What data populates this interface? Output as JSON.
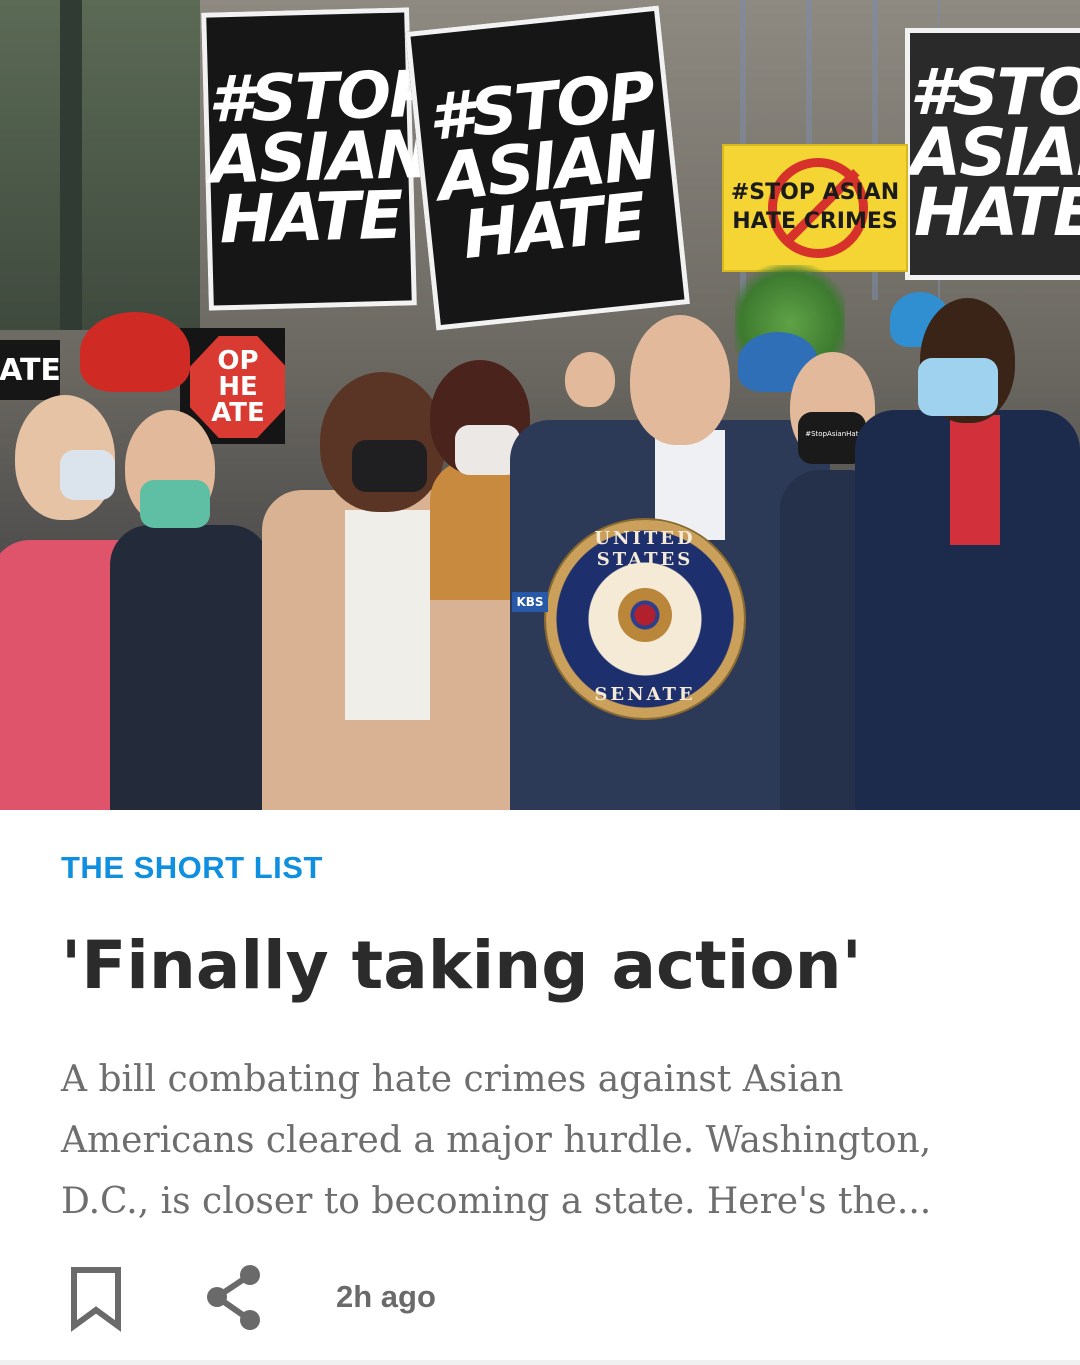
{
  "hero": {
    "signs": [
      {
        "lines": [
          "#STOP",
          "ASIAN",
          "HATE"
        ]
      },
      {
        "lines": [
          "#STOP",
          "ASIAN",
          "HATE"
        ]
      },
      {
        "lines": [
          "#STOP",
          "ASIAN",
          "HATE"
        ]
      }
    ],
    "yellow_sign": {
      "lines": [
        "#STOP ASIAN",
        "HATE CRIMES"
      ]
    },
    "red_sign": {
      "lines": [
        "OP",
        "HE",
        "ATE"
      ]
    },
    "left_strip": "ATE",
    "seal": {
      "top": "UNITED STATES",
      "bottom": "SENATE"
    },
    "mic_flag": "KBS",
    "mask_text": "#StopAsianHate"
  },
  "article": {
    "kicker": "THE SHORT LIST",
    "headline": "'Finally taking action'",
    "summary": "A bill combating hate crimes against Asian Americans cleared a major hurdle. Washington, D.C., is closer to becoming a state. Here's the...",
    "timestamp": "2h ago"
  },
  "icons": {
    "bookmark": "bookmark-icon",
    "share": "share-icon"
  },
  "colors": {
    "kicker": "#0e8fe0",
    "headline": "#2b2b2b",
    "summary": "#6e6e6e",
    "icon": "#6a6a6a"
  }
}
